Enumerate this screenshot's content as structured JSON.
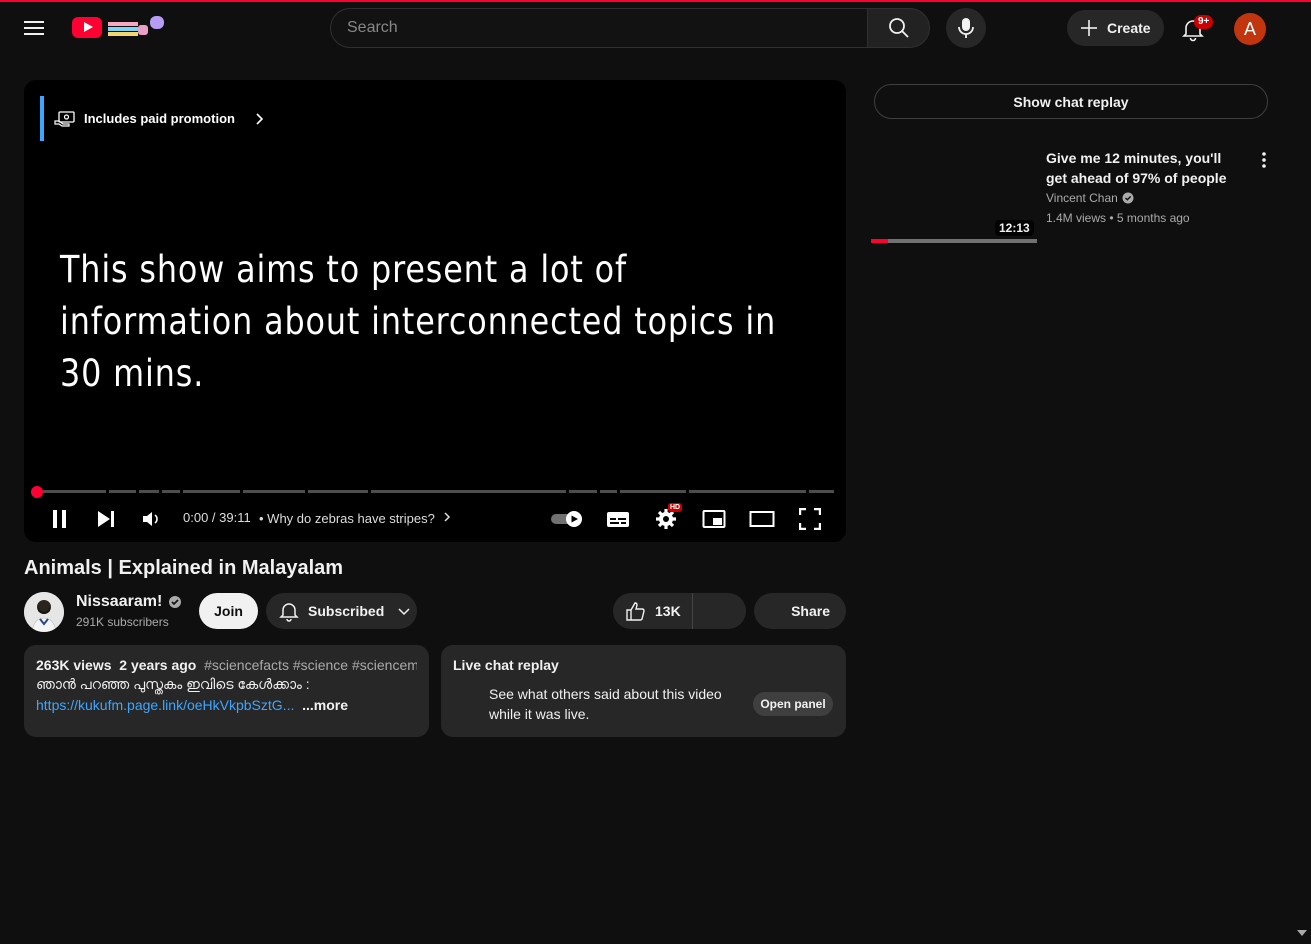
{
  "masthead": {
    "search_placeholder": "Search",
    "create_label": "Create",
    "notifications_badge": "9+",
    "avatar_letter": "A",
    "accent_color": "#ff0033"
  },
  "player": {
    "promo_label": "Includes paid promotion",
    "caption": "This show aims to present a lot of information about interconnected topics in 30 mins.",
    "time": "0:00 / 39:11",
    "chapter": "Why do zebras have stripes?",
    "settings_badge": "HD",
    "progress_fraction": 0
  },
  "video": {
    "title": "Animals | Explained in Malayalam",
    "channel": "Nissaaram!",
    "subscribers": "291K subscribers",
    "join_label": "Join",
    "subscribed_label": "Subscribed",
    "likes": "13K",
    "share_label": "Share"
  },
  "description": {
    "views": "263K views",
    "age": "2 years ago",
    "tags": "#sciencefacts #science #sciencem",
    "line2": "ഞാൻ പറഞ്ഞ പുസ്തകം ഇവിടെ കേൾക്കാം :",
    "link": "https://kukufm.page.link/oeHkVkpbSztG...",
    "more": "...more"
  },
  "live_chat": {
    "heading": "Live chat replay",
    "text": "See what others said about this video while it was live.",
    "open_label": "Open panel"
  },
  "sidebar": {
    "chat_replay_label": "Show chat replay",
    "recommendations": [
      {
        "title": "Give me 12 minutes, you'll get ahead of 97% of people",
        "channel": "Vincent Chan",
        "meta": "1.4M views • 5 months ago",
        "duration": "12:13",
        "watched_fraction": 0.1
      }
    ]
  }
}
